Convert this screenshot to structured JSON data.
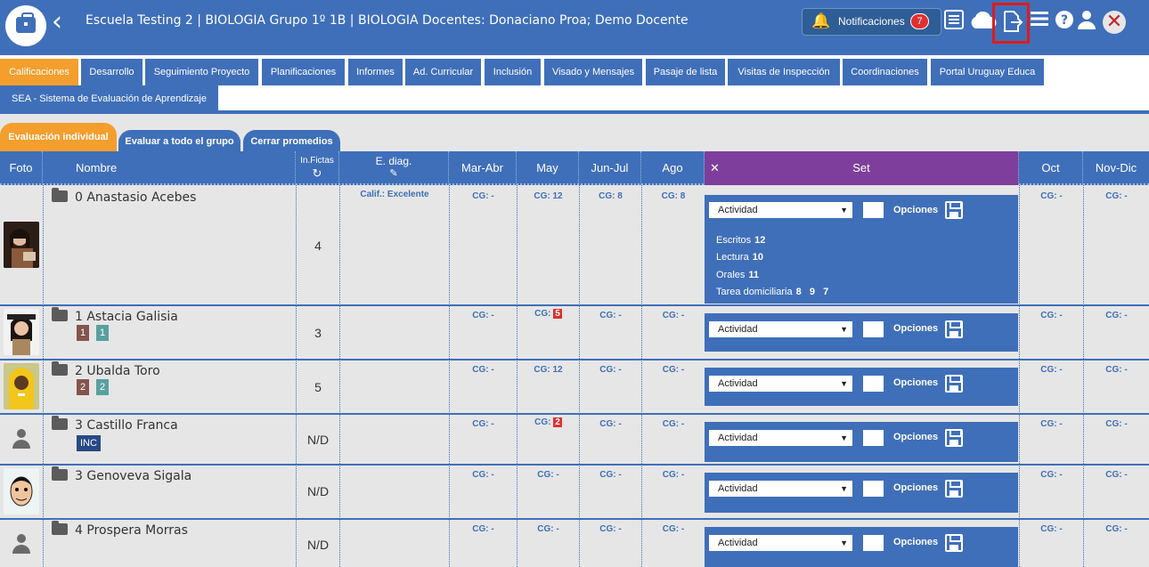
{
  "header": {
    "title": "Escuela Testing 2 | BIOLOGIA Grupo 1º 1B | BIOLOGIA Docentes: Donaciano Proa; Demo Docente",
    "notifications_label": "Notificaciones",
    "notifications_count": "7",
    "icons": [
      "bell-icon",
      "report-icon",
      "cloud-icon",
      "export-icon",
      "menu-icon",
      "help-icon",
      "user-icon",
      "close-icon"
    ]
  },
  "main_tabs": [
    {
      "label": "Calificaciones",
      "active": true
    },
    {
      "label": "Desarrollo"
    },
    {
      "label": "Seguimiento Proyecto"
    },
    {
      "label": "Planificaciones"
    },
    {
      "label": "Informes"
    },
    {
      "label": "Ad. Curricular"
    },
    {
      "label": "Inclusión"
    },
    {
      "label": "Visado y Mensajes"
    },
    {
      "label": "Pasaje de lista"
    },
    {
      "label": "Visitas de Inspección"
    },
    {
      "label": "Coordinaciones"
    },
    {
      "label": "Portal Uruguay Educa"
    },
    {
      "label": "SEA - Sistema de Evaluación de Aprendizaje"
    }
  ],
  "sub_tabs": [
    {
      "label": "Evaluación individual",
      "active": true
    },
    {
      "label": "Evaluar a todo el grupo"
    },
    {
      "label": "Cerrar promedios"
    }
  ],
  "columns": {
    "foto": "Foto",
    "nombre": "Nombre",
    "fictas": "In.Fictas",
    "ediag": "E. diag.",
    "mar_abr": "Mar-Abr",
    "may": "May",
    "jun_jul": "Jun-Jul",
    "ago": "Ago",
    "set_close": "✕",
    "set": "Set",
    "oct": "Oct",
    "nov_dic": "Nov-Dic"
  },
  "set_panel": {
    "select_value": "Actividad",
    "options_label": "Opciones"
  },
  "students": [
    {
      "name": "0 Anastasio Acebes",
      "fictas": "4",
      "ediag": "Calif.: Excelente",
      "mar_abr": "CG: -",
      "may": "CG: 12",
      "jun_jul": "CG: 8",
      "ago": "CG: 8",
      "oct": "CG: -",
      "nov_dic": "CG: -",
      "details": [
        {
          "label": "Escritos",
          "values": "12"
        },
        {
          "label": "Lectura",
          "values": "10"
        },
        {
          "label": "Orales",
          "values": "11"
        },
        {
          "label": "Tarea domiciliaria",
          "values": "8   9   7"
        }
      ]
    },
    {
      "name": "1 Astacia Galisia",
      "fictas": "3",
      "badges": [
        "1",
        "1"
      ],
      "mar_abr": "CG: -",
      "may_label": "CG:",
      "may_value": "5",
      "jun_jul": "CG: -",
      "ago": "CG: -",
      "oct": "CG: -",
      "nov_dic": "CG: -"
    },
    {
      "name": "2 Ubalda Toro",
      "fictas": "5",
      "badges": [
        "2",
        "2"
      ],
      "mar_abr": "CG: -",
      "may": "CG: 12",
      "jun_jul": "CG: -",
      "ago": "CG: -",
      "oct": "CG: -",
      "nov_dic": "CG: -"
    },
    {
      "name": "3 Castillo Franca",
      "fictas": "N/D",
      "status": "INC",
      "mar_abr": "CG: -",
      "may_label": "CG:",
      "may_value": "2",
      "jun_jul": "CG: -",
      "ago": "CG: -",
      "oct": "CG: -",
      "nov_dic": "CG: -"
    },
    {
      "name": "3 Genoveva Sigala",
      "fictas": "N/D",
      "mar_abr": "CG: -",
      "may": "CG: -",
      "jun_jul": "CG: -",
      "ago": "CG: -",
      "oct": "CG: -",
      "nov_dic": "CG: -"
    },
    {
      "name": "4 Prospera Morras",
      "fictas": "N/D",
      "mar_abr": "CG: -",
      "may": "CG: -",
      "jun_jul": "CG: -",
      "ago": "CG: -",
      "oct": "CG: -",
      "nov_dic": "CG: -"
    }
  ],
  "colors": {
    "primary": "#3f6fb9",
    "accent": "#f49e2d",
    "set_header": "#7d3f9b",
    "alert": "#e03030"
  }
}
